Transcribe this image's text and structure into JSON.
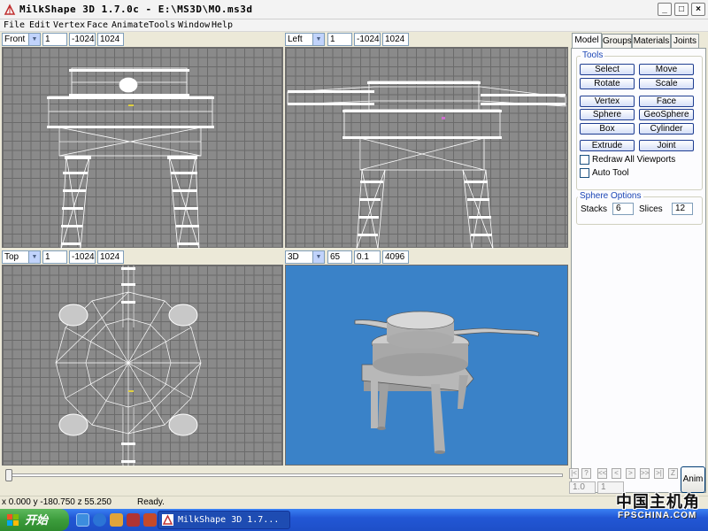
{
  "window": {
    "title": "MilkShape 3D 1.7.0c - E:\\MS3D\\MO.ms3d",
    "controls": {
      "minimize": "_",
      "maximize": "□",
      "close": "×"
    }
  },
  "menu": [
    "File",
    "Edit",
    "Vertex",
    "Face",
    "Animate",
    "Tools",
    "Window",
    "Help"
  ],
  "viewports": {
    "front": {
      "view": "Front",
      "a": "1",
      "b": "-1024",
      "c": "1024"
    },
    "left": {
      "view": "Left",
      "a": "1",
      "b": "-1024",
      "c": "1024"
    },
    "top": {
      "view": "Top",
      "a": "1",
      "b": "-1024",
      "c": "1024"
    },
    "persp": {
      "view": "3D",
      "a": "65",
      "b": "0.1",
      "c": "4096"
    }
  },
  "panel": {
    "tabs": [
      "Model",
      "Groups",
      "Materials",
      "Joints"
    ],
    "tools_title": "Tools",
    "tools": [
      [
        "Select",
        "Move"
      ],
      [
        "Rotate",
        "Scale"
      ],
      [
        "Vertex",
        "Face"
      ],
      [
        "Sphere",
        "GeoSphere"
      ],
      [
        "Box",
        "Cylinder"
      ],
      [
        "Extrude",
        "Joint"
      ]
    ],
    "checkboxes": [
      "Redraw All Viewports",
      "Auto Tool"
    ],
    "options_title": "Sphere Options",
    "stacks_label": "Stacks",
    "stacks_value": "6",
    "slices_label": "Slices",
    "slices_value": "12"
  },
  "animation": {
    "nav_buttons": [
      "|<",
      "?",
      "<<",
      "<",
      ">",
      ">>",
      ">|",
      "Z"
    ],
    "frame": "1.0",
    "total": "1",
    "button": "Anim"
  },
  "status": {
    "coords": "x 0.000 y -180.750 z 55.250",
    "message": "Ready."
  },
  "taskbar": {
    "start": "开始",
    "task_label": "MilkShape 3D 1.7..."
  },
  "watermark": {
    "cn": "中国主机角",
    "en": "FPSCHINA.COM"
  },
  "colors": {
    "viewport_grid": "#8a8a8a",
    "viewport_3d": "#3a82c8",
    "tab_title": "#1c46b5"
  }
}
